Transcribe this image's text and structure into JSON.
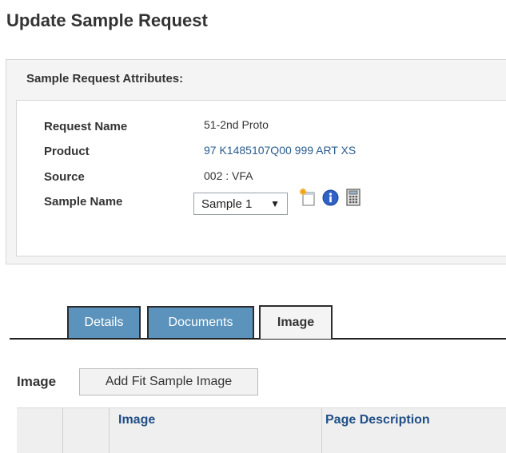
{
  "page": {
    "title": "Update Sample Request"
  },
  "attributes_panel": {
    "title": "Sample Request Attributes:",
    "fields": [
      {
        "label": "Request Name",
        "value": "51-2nd Proto"
      },
      {
        "label": "Product",
        "value": "97 K1485107Q00 999 ART XS"
      },
      {
        "label": "Source",
        "value": "002 : VFA"
      },
      {
        "label": "Sample Name",
        "value": "Sample 1"
      }
    ],
    "icons": [
      "new-document-icon",
      "info-icon",
      "calculator-icon"
    ]
  },
  "tabs": [
    {
      "label": "Details",
      "active": false
    },
    {
      "label": "Documents",
      "active": false
    },
    {
      "label": "Image",
      "active": true
    }
  ],
  "image_section": {
    "label": "Image",
    "add_button": "Add Fit Sample Image",
    "columns": [
      "",
      "",
      "Image",
      "Page Description"
    ]
  },
  "colors": {
    "tab_inactive": "#5b93bd",
    "link": "#2a5b8f",
    "header_text": "#1f4f86"
  }
}
